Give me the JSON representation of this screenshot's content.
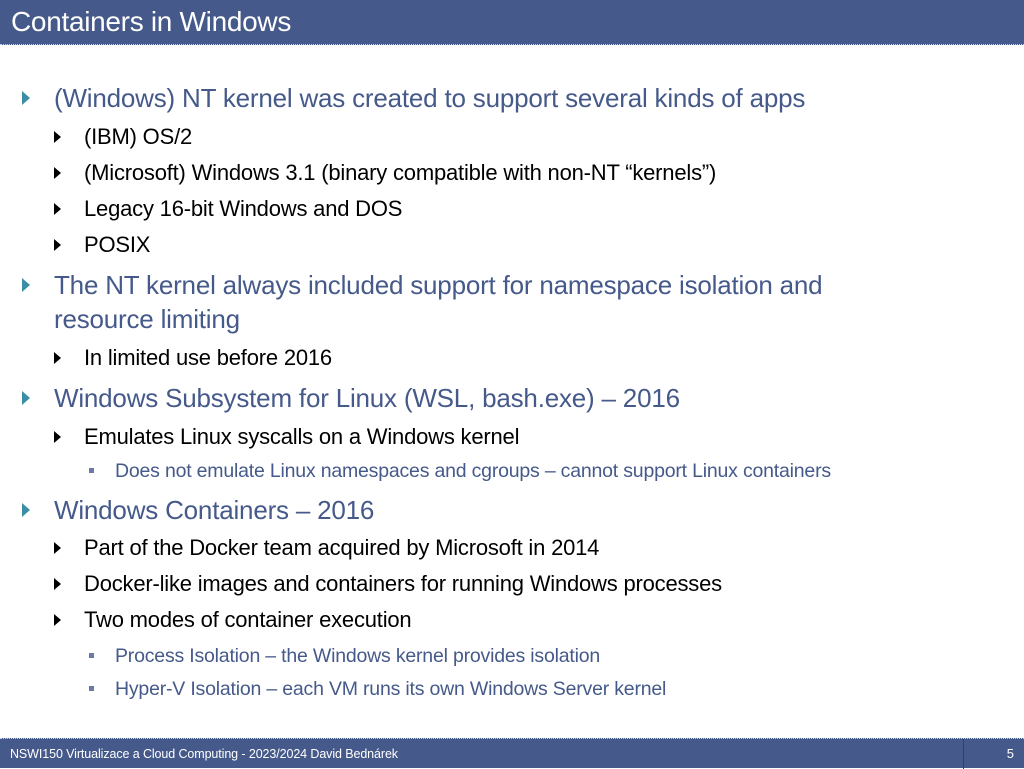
{
  "slide": {
    "title": "Containers in Windows",
    "colors": {
      "header_bg": "#45598a",
      "level1_text": "#45598a",
      "level1_bullet": "#3a8ea5",
      "level2_text": "#000000",
      "level3_text": "#45598a"
    },
    "bullets": [
      {
        "level": 1,
        "text": "(Windows) NT kernel was created to support several kinds of apps"
      },
      {
        "level": 2,
        "text": "(IBM) OS/2"
      },
      {
        "level": 2,
        "text": "(Microsoft) Windows 3.1 (binary compatible with non-NT “kernels”)"
      },
      {
        "level": 2,
        "text": "Legacy 16-bit Windows and DOS"
      },
      {
        "level": 2,
        "text": "POSIX"
      },
      {
        "level": 1,
        "text": "The NT kernel always included support for namespace isolation and",
        "continuation": "resource limiting"
      },
      {
        "level": 2,
        "text": "In limited use before 2016"
      },
      {
        "level": 1,
        "text": "Windows Subsystem for Linux (WSL, bash.exe) – 2016"
      },
      {
        "level": 2,
        "text": "Emulates Linux syscalls on a Windows kernel"
      },
      {
        "level": 3,
        "text": "Does not emulate Linux namespaces and cgroups – cannot support Linux containers"
      },
      {
        "level": 1,
        "text": "Windows Containers – 2016"
      },
      {
        "level": 2,
        "text": "Part of the Docker team acquired by Microsoft in 2014"
      },
      {
        "level": 2,
        "text": "Docker-like images and containers for running Windows processes"
      },
      {
        "level": 2,
        "text": "Two modes of container execution"
      },
      {
        "level": 3,
        "text": "Process Isolation – the Windows kernel provides isolation"
      },
      {
        "level": 3,
        "text": "Hyper-V Isolation – each VM runs its own Windows Server kernel"
      }
    ]
  },
  "footer": {
    "text": "NSWI150 Virtualizace a Cloud Computing - 2023/2024 David Bednárek",
    "page_number": "5"
  }
}
